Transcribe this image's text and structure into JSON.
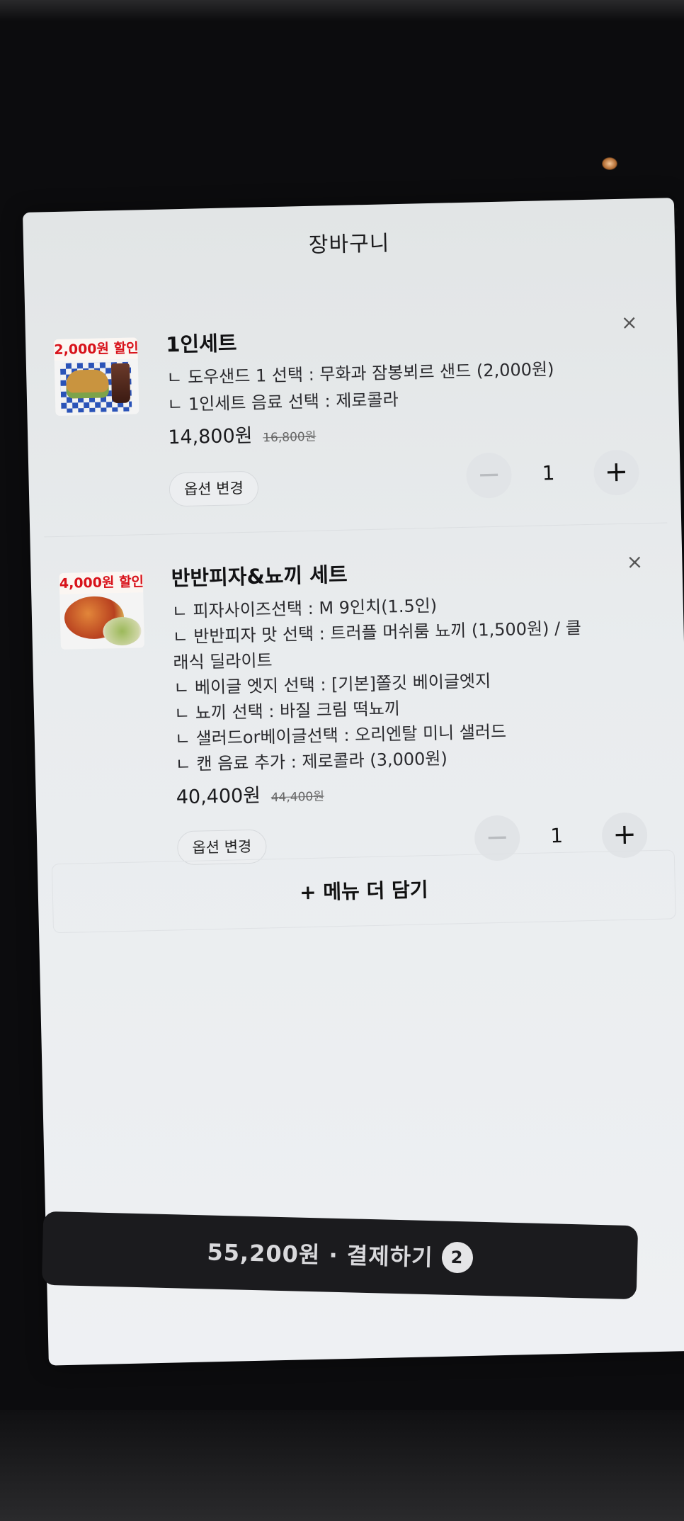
{
  "cart": {
    "title": "장바구니",
    "close_symbol": "✕",
    "items": [
      {
        "badge": "2,000원 할인",
        "name": "1인세트",
        "options": [
          "ㄴ 도우샌드 1 선택 : 무화과 잠봉뵈르 샌드 (2,000원)",
          "ㄴ 1인세트 음료 선택 : 제로콜라"
        ],
        "price": "14,800원",
        "original_price": "16,800원",
        "option_button": "옵션 변경",
        "quantity": "1",
        "minus": "−",
        "plus": "+",
        "remove": "×"
      },
      {
        "badge": "4,000원 할인",
        "name": "반반피자&뇨끼 세트",
        "options": [
          "ㄴ 피자사이즈선택 : M 9인치(1.5인)",
          "ㄴ 반반피자 맛 선택 : 트러플 머쉬룸 뇨끼 (1,500원) / 클",
          "래식 딜라이트",
          "ㄴ 베이글 엣지 선택 : [기본]쫄깃 베이글엣지",
          "ㄴ 뇨끼 선택 : 바질 크림 떡뇨끼",
          "ㄴ 샐러드or베이글선택 : 오리엔탈 미니 샐러드",
          "ㄴ 캔 음료 추가 : 제로콜라 (3,000원)"
        ],
        "price": "40,400원",
        "original_price": "44,400원",
        "option_button": "옵션 변경",
        "quantity": "1",
        "minus": "−",
        "plus": "+",
        "remove": "×"
      }
    ],
    "add_more": "+ 메뉴 더 담기",
    "checkout": {
      "label": "55,200원 · 결제하기",
      "count": "2"
    }
  }
}
